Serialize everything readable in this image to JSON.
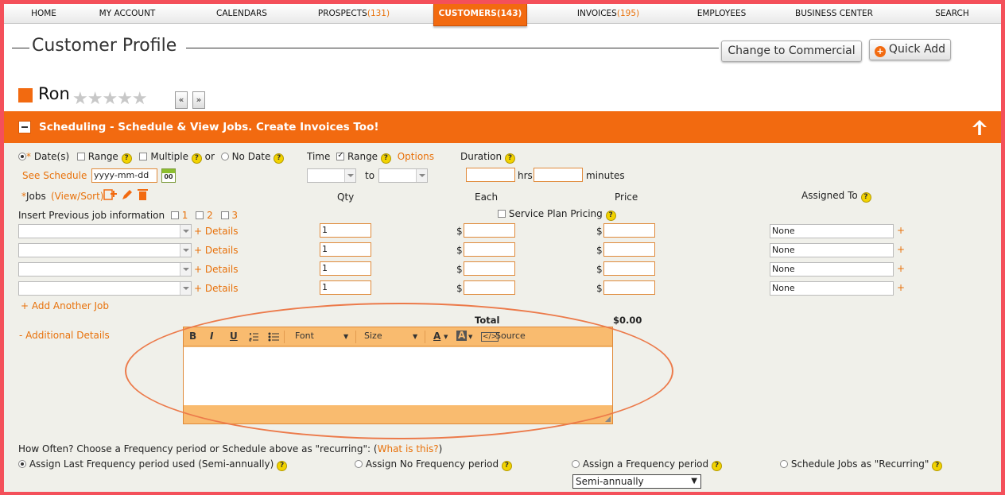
{
  "nav": {
    "items": [
      {
        "label": "HOME",
        "count": ""
      },
      {
        "label": "MY ACCOUNT",
        "count": ""
      },
      {
        "label": "CALENDARS",
        "count": ""
      },
      {
        "label": "PROSPECTS",
        "count": "(131)"
      },
      {
        "label": "CUSTOMERS",
        "count": "(143)"
      },
      {
        "label": "INVOICES",
        "count": "(195)"
      },
      {
        "label": "EMPLOYEES",
        "count": ""
      },
      {
        "label": "BUSINESS CENTER",
        "count": ""
      },
      {
        "label": "SEARCH",
        "count": ""
      }
    ],
    "active": "CUSTOMERS"
  },
  "header": {
    "title": "Customer Profile",
    "change_button": "Change to Commercial",
    "quick_add_button": "Quick Add",
    "quick_add_icon": "+"
  },
  "customer": {
    "name": "Ron",
    "stars": "★★★★★",
    "prev_label": "«",
    "next_label": "»"
  },
  "section": {
    "title": "Scheduling - Schedule & View Jobs. Create Invoices Too!"
  },
  "dates": {
    "required_mark": "*",
    "dates_label": "Date(s)",
    "range_label": "Range",
    "multiple_label": "Multiple",
    "or_label": "or",
    "no_date_label": "No Date",
    "see_schedule": "See Schedule",
    "date_placeholder": "yyyy-mm-dd",
    "calendar_day": "00"
  },
  "time": {
    "label": "Time",
    "range_label": "Range",
    "options_link": "Options",
    "to_label": "to"
  },
  "duration": {
    "label": "Duration",
    "hrs": "hrs",
    "minutes": "minutes"
  },
  "jobs": {
    "required_mark": "*",
    "label": "Jobs",
    "view_sort": "(View/Sort)",
    "insert_prev": "Insert Previous job information",
    "prev_options": [
      "1",
      "2",
      "3"
    ],
    "service_plan": "Service Plan Pricing",
    "details_label": "+ Details",
    "currency": "$",
    "add_job": "+ Add Another Job",
    "total_label": "Total",
    "total_value": "$0.00",
    "rows": [
      {
        "qty": "1",
        "assigned": "None"
      },
      {
        "qty": "1",
        "assigned": "None"
      },
      {
        "qty": "1",
        "assigned": "None"
      },
      {
        "qty": "1",
        "assigned": "None"
      }
    ],
    "columns": {
      "qty": "Qty",
      "each": "Each",
      "price": "Price",
      "assigned": "Assigned To"
    },
    "add_symbol": "+"
  },
  "additional": {
    "label": "- Additional Details",
    "toolbar": {
      "bold": "B",
      "italic": "I",
      "underline": "U",
      "font": "Font",
      "size": "Size",
      "text_color": "A",
      "bg_color": "A",
      "source": "Source"
    }
  },
  "frequency": {
    "prompt": "How Often? Choose a Frequency period or Schedule above as \"recurring\": (",
    "what_is_this": "What is this?",
    "close_paren": ")",
    "opt1": "Assign Last Frequency period used (Semi-annually)",
    "opt2": "Assign No Frequency period",
    "opt3": "Assign a Frequency period",
    "opt4": "Schedule Jobs as \"Recurring\"",
    "selected_period": "Semi-annually"
  },
  "help_symbol": "?",
  "colors": {
    "accent": "#f26a10",
    "frame": "#f4505a",
    "help": "#f2d300"
  }
}
